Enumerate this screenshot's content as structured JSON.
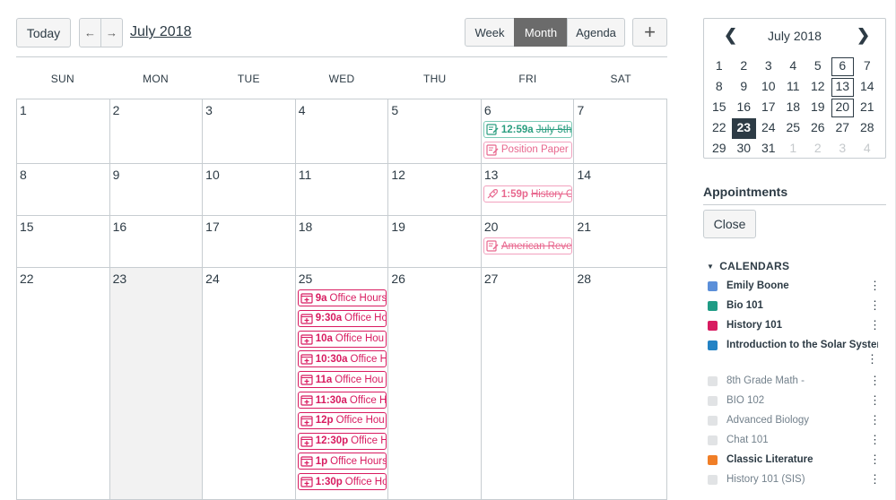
{
  "toolbar": {
    "today_label": "Today",
    "prev_label": "←",
    "next_label": "→",
    "month_title": "July 2018",
    "views": [
      "Week",
      "Month",
      "Agenda"
    ],
    "active_view": "Month",
    "add_label": "+"
  },
  "weekdays": [
    "SUN",
    "MON",
    "TUE",
    "WED",
    "THU",
    "FRI",
    "SAT"
  ],
  "weeks": [
    [
      "1",
      "2",
      "3",
      "4",
      "5",
      "6",
      "7"
    ],
    [
      "8",
      "9",
      "10",
      "11",
      "12",
      "13",
      "14"
    ],
    [
      "15",
      "16",
      "17",
      "18",
      "19",
      "20",
      "21"
    ],
    [
      "22",
      "23",
      "24",
      "25",
      "26",
      "27",
      "28"
    ]
  ],
  "events": {
    "fri6": [
      {
        "time": "12:59a",
        "title": "July 5th",
        "style": "teal",
        "strike": true,
        "icon": "assignment-icon"
      },
      {
        "time": "",
        "title": "Position Paper",
        "style": "pink",
        "strike": false,
        "icon": "assignment-icon"
      }
    ],
    "fri13": [
      {
        "time": "1:59p",
        "title": "History C",
        "style": "pink",
        "strike": true,
        "icon": "quiz-rocket-icon"
      }
    ],
    "fri20": [
      {
        "time": "",
        "title": "American Reve",
        "style": "pink",
        "strike": true,
        "icon": "assignment-icon"
      }
    ],
    "wed25": [
      {
        "time": "9a",
        "title": "Office Hours"
      },
      {
        "time": "9:30a",
        "title": "Office Ho"
      },
      {
        "time": "10a",
        "title": "Office Hou"
      },
      {
        "time": "10:30a",
        "title": "Office H"
      },
      {
        "time": "11a",
        "title": "Office Hou"
      },
      {
        "time": "11:30a",
        "title": "Office H"
      },
      {
        "time": "12p",
        "title": "Office Hou"
      },
      {
        "time": "12:30p",
        "title": "Office H"
      },
      {
        "time": "1p",
        "title": "Office Hours"
      },
      {
        "time": "1:30p",
        "title": "Office Ho"
      }
    ]
  },
  "mini_calendar": {
    "title": "July 2018",
    "rows": [
      [
        "1",
        "2",
        "3",
        "4",
        "5",
        "6",
        "7"
      ],
      [
        "8",
        "9",
        "10",
        "11",
        "12",
        "13",
        "14"
      ],
      [
        "15",
        "16",
        "17",
        "18",
        "19",
        "20",
        "21"
      ],
      [
        "22",
        "23",
        "24",
        "25",
        "26",
        "27",
        "28"
      ],
      [
        "29",
        "30",
        "31",
        "1",
        "2",
        "3",
        "4"
      ]
    ],
    "boxed": [
      "6",
      "13",
      "20"
    ],
    "selected": "23"
  },
  "appointments": {
    "title": "Appointments",
    "close_label": "Close"
  },
  "calendars": {
    "header": "CALENDARS",
    "items": [
      {
        "name": "Emily Boone",
        "color": "#5b8fd9",
        "active": true
      },
      {
        "name": "Bio 101",
        "color": "#1f9c85",
        "active": true
      },
      {
        "name": "History 101",
        "color": "#d81b60",
        "active": true
      },
      {
        "name": "Introduction to the Solar System",
        "color": "#2382c4",
        "active": true
      },
      {
        "name": "8th Grade Math -",
        "color": "#e1e3e5",
        "active": false
      },
      {
        "name": "BIO 102",
        "color": "#e1e3e5",
        "active": false
      },
      {
        "name": "Advanced Biology",
        "color": "#e1e3e5",
        "active": false
      },
      {
        "name": "Chat 101",
        "color": "#e1e3e5",
        "active": false
      },
      {
        "name": "Classic Literature",
        "color": "#f07e27",
        "active": true
      },
      {
        "name": "History 101 (SIS)",
        "color": "#e1e3e5",
        "active": false
      }
    ]
  }
}
